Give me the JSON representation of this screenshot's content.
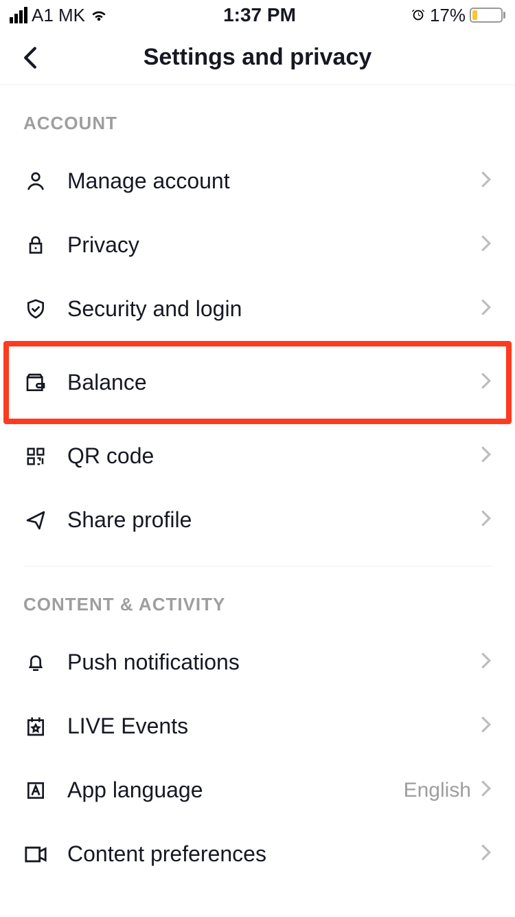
{
  "statusbar": {
    "carrier": "A1 MK",
    "time": "1:37 PM",
    "battery_percent": "17%"
  },
  "header": {
    "title": "Settings and privacy"
  },
  "sections": {
    "account_title": "ACCOUNT",
    "content_title": "CONTENT & ACTIVITY"
  },
  "items": {
    "manage_account": "Manage account",
    "privacy": "Privacy",
    "security": "Security and login",
    "balance": "Balance",
    "qrcode": "QR code",
    "share_profile": "Share profile",
    "push": "Push notifications",
    "live_events": "LIVE Events",
    "app_language": "App language",
    "app_language_value": "English",
    "content_prefs": "Content preferences"
  }
}
